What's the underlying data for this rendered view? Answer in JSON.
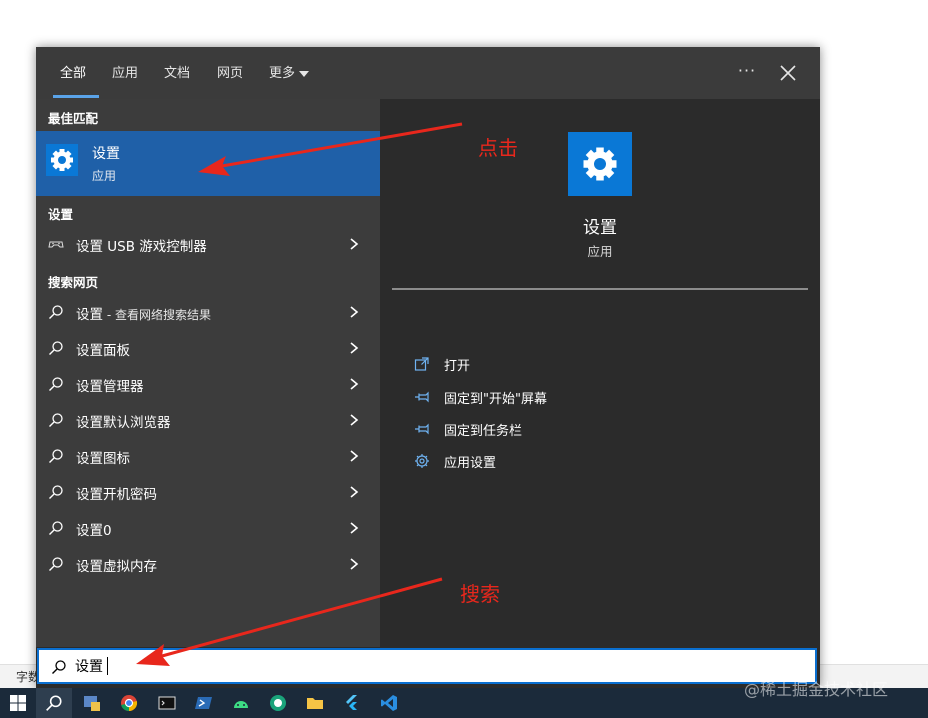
{
  "background_status": {
    "text": "字数"
  },
  "tabs": [
    {
      "label": "全部",
      "active": true
    },
    {
      "label": "应用"
    },
    {
      "label": "文档"
    },
    {
      "label": "网页"
    },
    {
      "label": "更多"
    }
  ],
  "topbar": {
    "ellipsis": "···"
  },
  "groups": {
    "best_match": "最佳匹配",
    "settings": "设置",
    "web": "搜索网页"
  },
  "best_match": {
    "title": "设置",
    "subtitle": "应用"
  },
  "settings_results": [
    {
      "label": "设置 USB 游戏控制器"
    }
  ],
  "web_results": [
    {
      "label": "设置",
      "suffix": " - 查看网络搜索结果"
    },
    {
      "label": "设置面板"
    },
    {
      "label": "设置管理器"
    },
    {
      "label": "设置默认浏览器"
    },
    {
      "label": "设置图标"
    },
    {
      "label": "设置开机密码"
    },
    {
      "label": "设置0"
    },
    {
      "label": "设置虚拟内存"
    }
  ],
  "preview": {
    "title": "设置",
    "subtitle": "应用",
    "actions": [
      {
        "label": "打开",
        "icon": "open-icon"
      },
      {
        "label": "固定到\"开始\"屏幕",
        "icon": "pin-icon"
      },
      {
        "label": "固定到任务栏",
        "icon": "pin-icon"
      },
      {
        "label": "应用设置",
        "icon": "gear-icon"
      }
    ]
  },
  "search": {
    "value": "设置"
  },
  "annotations": {
    "click": "点击",
    "search": "搜索"
  },
  "watermark": "@稀土掘金技术社区",
  "colors": {
    "accent": "#0a78d6",
    "selection": "#1f60a8",
    "annotation": "#e8271c"
  },
  "taskbar": {
    "items": [
      "windows-start-icon",
      "search-icon",
      "task-manager-icon",
      "chrome-icon",
      "terminal-icon",
      "powershell-icon",
      "android-studio-icon",
      "app-icon",
      "file-explorer-icon",
      "flutter-icon",
      "vscode-icon"
    ]
  }
}
